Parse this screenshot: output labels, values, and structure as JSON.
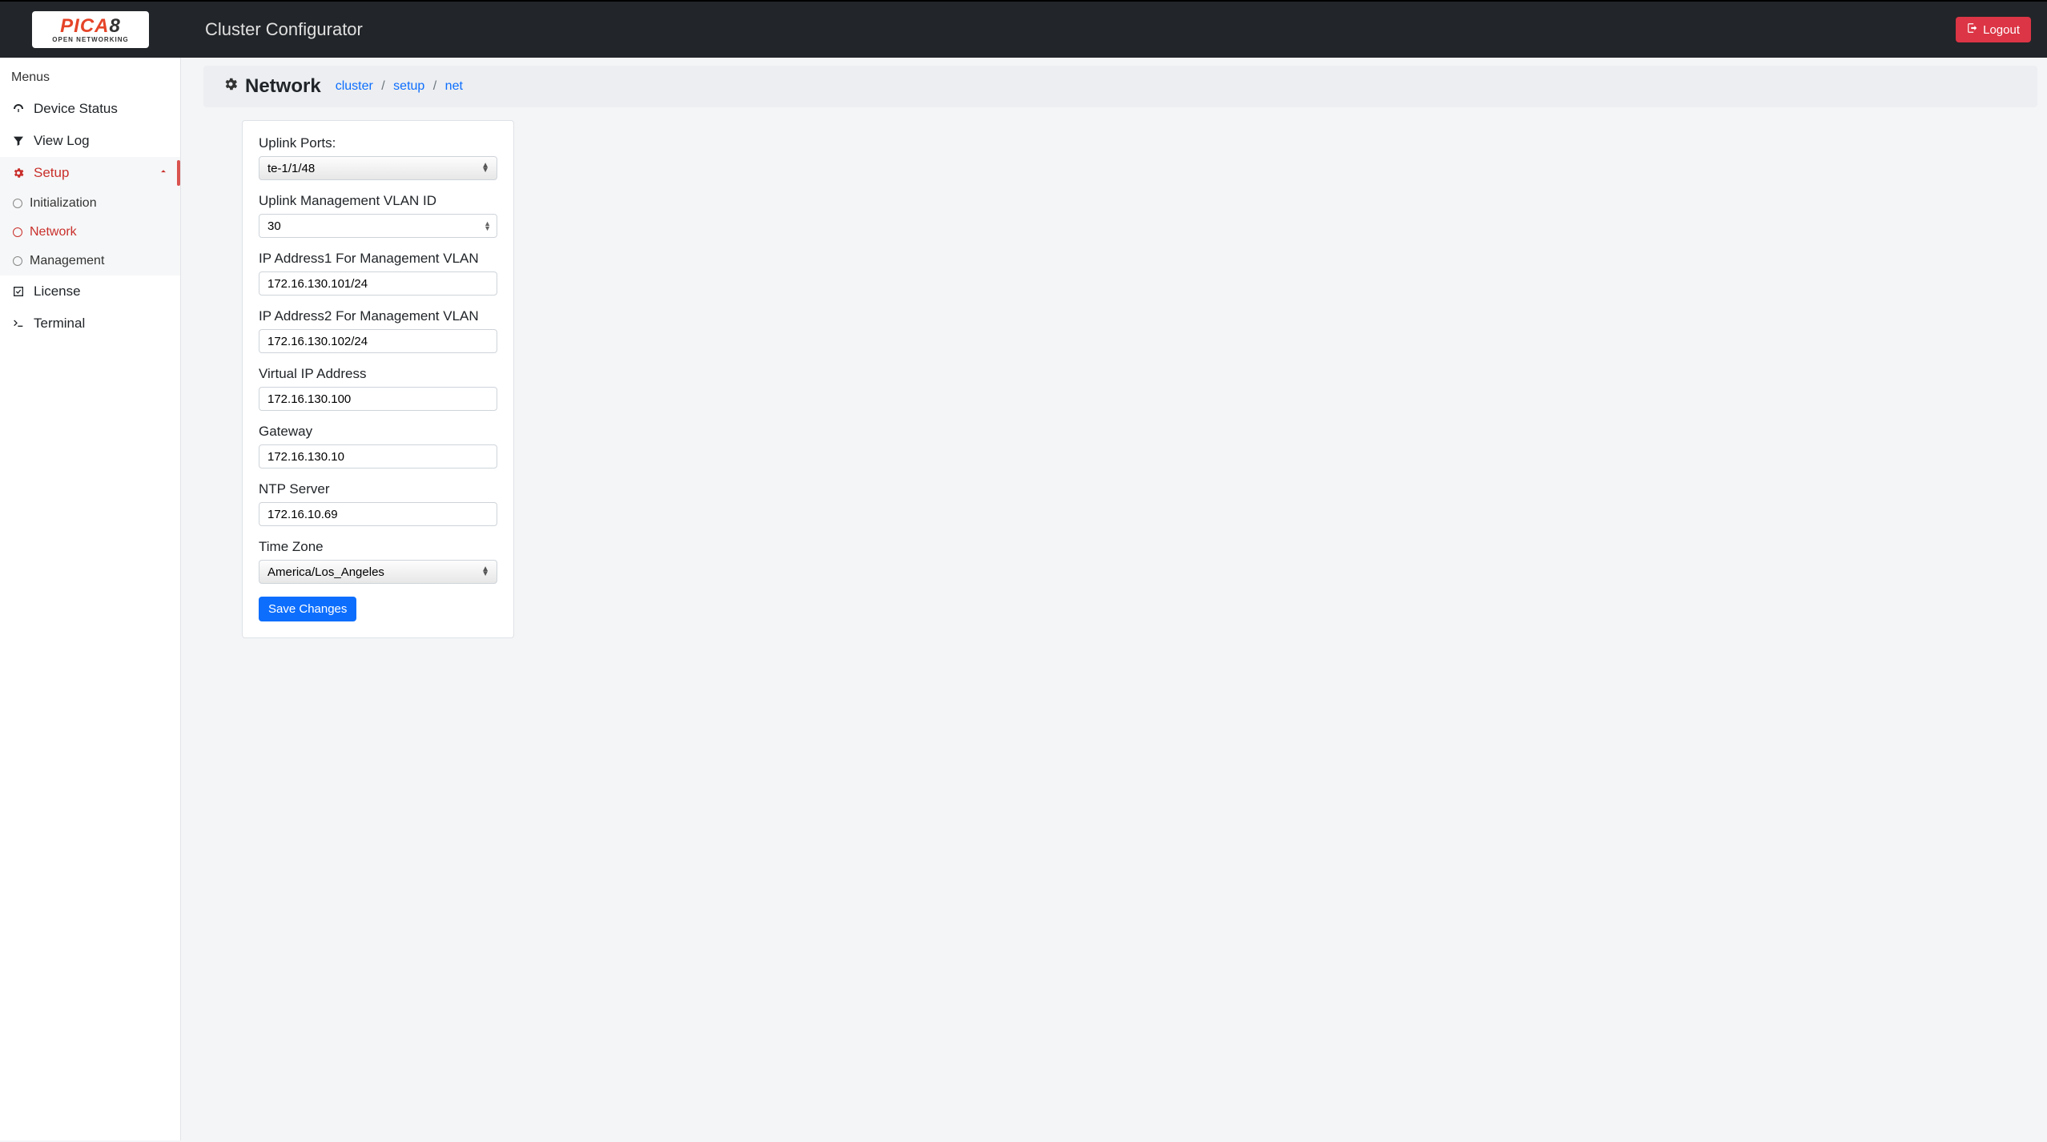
{
  "header": {
    "app_title": "Cluster Configurator",
    "logout_label": "Logout"
  },
  "sidebar": {
    "heading": "Menus",
    "device_status": "Device Status",
    "view_log": "View Log",
    "setup": "Setup",
    "initialization": "Initialization",
    "network": "Network",
    "management": "Management",
    "license": "License",
    "terminal": "Terminal"
  },
  "page": {
    "title": "Network",
    "breadcrumb": {
      "cluster": "cluster",
      "setup": "setup",
      "net": "net"
    }
  },
  "form": {
    "uplink_ports": {
      "label": "Uplink Ports:",
      "value": "te-1/1/48"
    },
    "vlan_id": {
      "label": "Uplink Management VLAN ID",
      "value": "30"
    },
    "ip1": {
      "label": "IP Address1 For Management VLAN",
      "value": "172.16.130.101/24"
    },
    "ip2": {
      "label": "IP Address2 For Management VLAN",
      "value": "172.16.130.102/24"
    },
    "vip": {
      "label": "Virtual IP Address",
      "value": "172.16.130.100"
    },
    "gateway": {
      "label": "Gateway",
      "value": "172.16.130.10"
    },
    "ntp": {
      "label": "NTP Server",
      "value": "172.16.10.69"
    },
    "timezone": {
      "label": "Time Zone",
      "value": "America/Los_Angeles"
    },
    "save_label": "Save Changes"
  }
}
